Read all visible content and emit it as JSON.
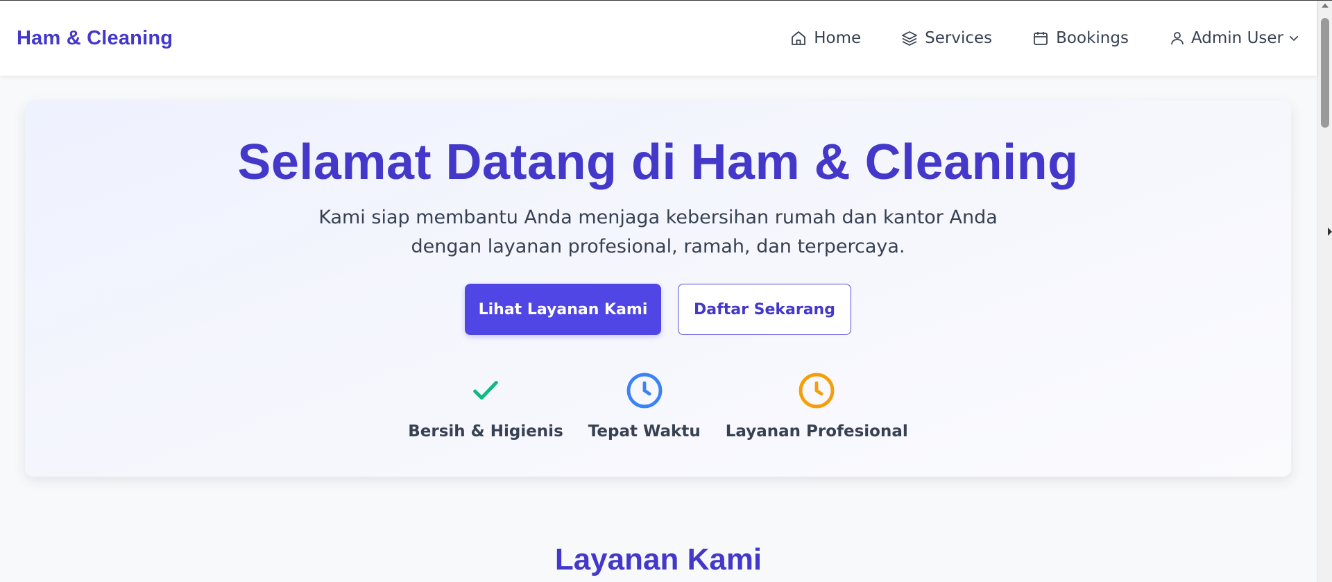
{
  "brand": "Ham & Cleaning",
  "nav": {
    "home": "Home",
    "services": "Services",
    "bookings": "Bookings",
    "user": "Admin User"
  },
  "hero": {
    "title": "Selamat Datang di Ham & Cleaning",
    "subtitle_line1": "Kami siap membantu Anda menjaga kebersihan rumah dan kantor Anda",
    "subtitle_line2": "dengan layanan profesional, ramah, dan terpercaya.",
    "primary_button": "Lihat Layanan Kami",
    "secondary_button": "Daftar Sekarang",
    "features": [
      {
        "label": "Bersih & Higienis",
        "icon": "check-icon",
        "color": "#10b981"
      },
      {
        "label": "Tepat Waktu",
        "icon": "clock-icon",
        "color": "#3b82f6"
      },
      {
        "label": "Layanan Profesional",
        "icon": "clock-icon",
        "color": "#f59e0b"
      }
    ]
  },
  "section": {
    "title": "Layanan Kami"
  },
  "colors": {
    "accent": "#4338ca",
    "primary_button": "#4f46e5"
  }
}
